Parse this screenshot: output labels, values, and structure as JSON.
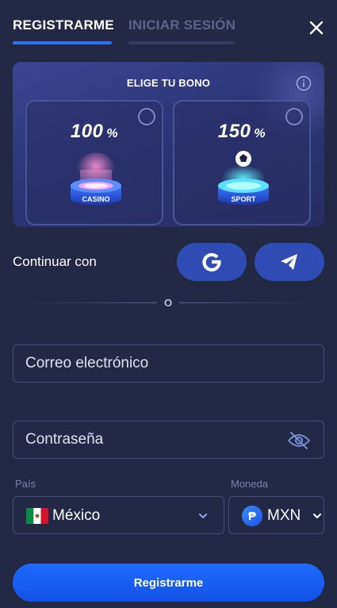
{
  "tabs": [
    {
      "label": "REGISTRARME",
      "active": true
    },
    {
      "label": "INICIAR SESIÓN",
      "active": false
    }
  ],
  "close_icon": "close-icon",
  "bonus": {
    "title": "ELIGE TU BONO",
    "info_icon": "info-icon",
    "options": [
      {
        "percent": "100",
        "sign": "%",
        "badge": "CASINO",
        "selected": false
      },
      {
        "percent": "150",
        "sign": "%",
        "badge": "SPORT",
        "selected": false
      }
    ]
  },
  "social": {
    "label": "Continuar con",
    "providers": [
      "google-icon",
      "telegram-icon"
    ]
  },
  "divider": "O",
  "form": {
    "email_placeholder": "Correo electrónico",
    "password_placeholder": "Contraseña",
    "country_label": "País",
    "country_value": "México",
    "currency_label": "Moneda",
    "currency_symbol": "₱",
    "currency_value": "MXN",
    "submit_label": "Registrarme"
  },
  "colors": {
    "background": "#232845",
    "accent": "#2f73f2",
    "social_button": "#2e4cb3",
    "field_border": "#454c75"
  }
}
